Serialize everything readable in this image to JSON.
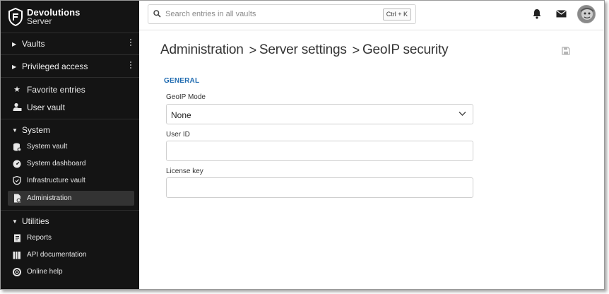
{
  "brand": {
    "name": "Devolutions",
    "product": "Server"
  },
  "sidebar": {
    "groups": [
      {
        "label": "Vaults"
      },
      {
        "label": "Privileged access"
      }
    ],
    "favorites": [
      {
        "label": "Favorite entries",
        "icon": "star-icon"
      },
      {
        "label": "User vault",
        "icon": "user-vault-icon"
      }
    ],
    "system": {
      "label": "System",
      "items": [
        {
          "label": "System vault",
          "icon": "system-vault-icon"
        },
        {
          "label": "System dashboard",
          "icon": "dashboard-icon"
        },
        {
          "label": "Infrastructure vault",
          "icon": "infrastructure-icon"
        },
        {
          "label": "Administration",
          "icon": "administration-icon",
          "active": true
        }
      ]
    },
    "utilities": {
      "label": "Utilities",
      "items": [
        {
          "label": "Reports",
          "icon": "reports-icon"
        },
        {
          "label": "API documentation",
          "icon": "api-icon"
        },
        {
          "label": "Online help",
          "icon": "help-icon"
        }
      ]
    }
  },
  "topbar": {
    "search_placeholder": "Search entries in all vaults",
    "shortcut": "Ctrl + K"
  },
  "breadcrumb": [
    "Administration",
    "Server settings",
    "GeoIP security"
  ],
  "form": {
    "section": "GENERAL",
    "geoip_mode": {
      "label": "GeoIP Mode",
      "value": "None"
    },
    "user_id": {
      "label": "User ID",
      "value": ""
    },
    "license_key": {
      "label": "License key",
      "value": ""
    }
  },
  "colors": {
    "sidebar_bg": "#141414",
    "accent": "#1e6ab0"
  }
}
